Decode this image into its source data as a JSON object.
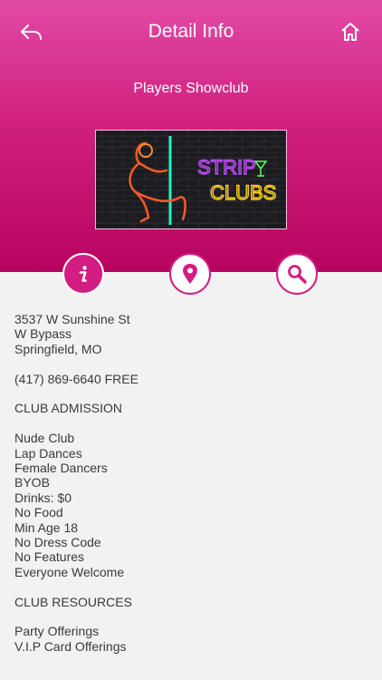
{
  "nav": {
    "title": "Detail Info",
    "back_icon": "reply-arrow-icon",
    "home_icon": "home-icon"
  },
  "club": {
    "name": "Players Showclub",
    "banner_text_line1": "STRIP",
    "banner_text_line2": "CLUBS"
  },
  "actions": [
    {
      "icon": "info-icon",
      "active": true
    },
    {
      "icon": "map-pin-icon",
      "active": false
    },
    {
      "icon": "search-icon",
      "active": false
    }
  ],
  "address": {
    "line1": "3537 W Sunshine St",
    "line2": "W Bypass",
    "line3": "Springfield, MO"
  },
  "phone": "(417) 869-6640 FREE",
  "admission": {
    "heading": "CLUB ADMISSION",
    "items": [
      "Nude Club",
      "Lap Dances",
      "Female Dancers",
      "BYOB",
      "Drinks: $0",
      "No Food",
      "Min Age 18",
      "No Dress Code",
      "No Features",
      "Everyone Welcome"
    ]
  },
  "resources": {
    "heading": "CLUB RESOURCES",
    "items": [
      "Party Offerings",
      "V.I.P Card Offerings"
    ]
  },
  "colors": {
    "accent": "#d31d82",
    "header_top": "#e24aa6",
    "header_bottom": "#b8045f",
    "background": "#f2f2f2",
    "text": "#3a3a3a"
  }
}
